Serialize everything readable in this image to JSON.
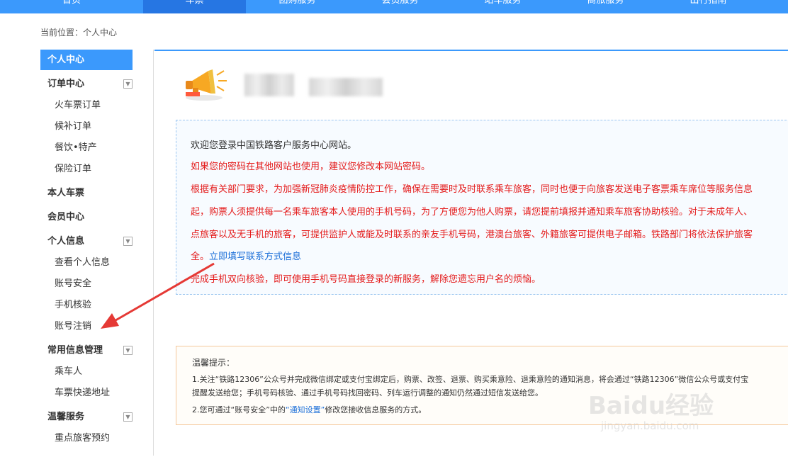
{
  "nav": {
    "items": [
      "首页",
      "车票",
      "团购服务",
      "会员服务",
      "站车服务",
      "商旅服务",
      "出行指南"
    ],
    "active_index": 1
  },
  "breadcrumb": "当前位置：个人中心",
  "sidebar": {
    "active": "个人中心",
    "order_center": "订单中心",
    "train_orders": "火车票订单",
    "waitlist_orders": "候补订单",
    "catering_orders": "餐饮•特产",
    "insurance_orders": "保险订单",
    "my_tickets": "本人车票",
    "member_center": "会员中心",
    "personal_info": "个人信息",
    "view_info": "查看个人信息",
    "account_security": "账号安全",
    "phone_verify": "手机核验",
    "account_cancel": "账号注销",
    "common_info": "常用信息管理",
    "passengers": "乘车人",
    "delivery_address": "车票快递地址",
    "care_service": "温馨服务",
    "priority_booking": "重点旅客预约"
  },
  "notice": {
    "welcome": "欢迎您登录中国铁路客户服务中心网站。",
    "password_warning": "如果您的密码在其他网站也使用，建议您修改本网站密码。",
    "line1": "根据有关部门要求，为加强新冠肺炎疫情防控工作，确保在需要时及时联系乘车旅客，同时也便于向旅客发送电子客票乘车席位等服务信息",
    "line2": "起，购票人须提供每一名乘车旅客本人使用的手机号码，为了方便您为他人购票，请您提前填报并通知乘车旅客协助核验。对于未成年人、",
    "line3": "点旅客以及无手机的旅客，可提供监护人或能及时联系的亲友手机号码，港澳台旅客、外籍旅客可提供电子邮箱。铁路部门将依法保护旅客",
    "line4_prefix": "全。",
    "line4_link": "立即填写联系方式信息",
    "line5": "完成手机双向核验，即可使用手机号码直接登录的新服务，解除您遗忘用户名的烦恼。"
  },
  "tips": {
    "title": "温馨提示：",
    "line1": "1.关注“铁路12306”公众号并完成微信绑定或支付宝绑定后，购票、改签、退票、购买乘意险、退乘意险的通知消息，将会通过“铁路12306”微信公众号或支付宝",
    "line2": "提醒发送给您；手机号码核验、通过手机号码找回密码、列车运行调整的通知仍然通过短信发送给您。",
    "line3_prefix": "2.您可通过“账号安全”中的",
    "line3_link": "“通知设置”",
    "line3_suffix": "修改您接收信息服务的方式。"
  },
  "watermark": {
    "text": "Baidu经验",
    "sub": "jingyan.baidu.com"
  },
  "colors": {
    "accent": "#3b99fc",
    "warning_red": "#e41b1b",
    "link_blue": "#1a6ed8",
    "annotation_arrow": "#e53935"
  }
}
